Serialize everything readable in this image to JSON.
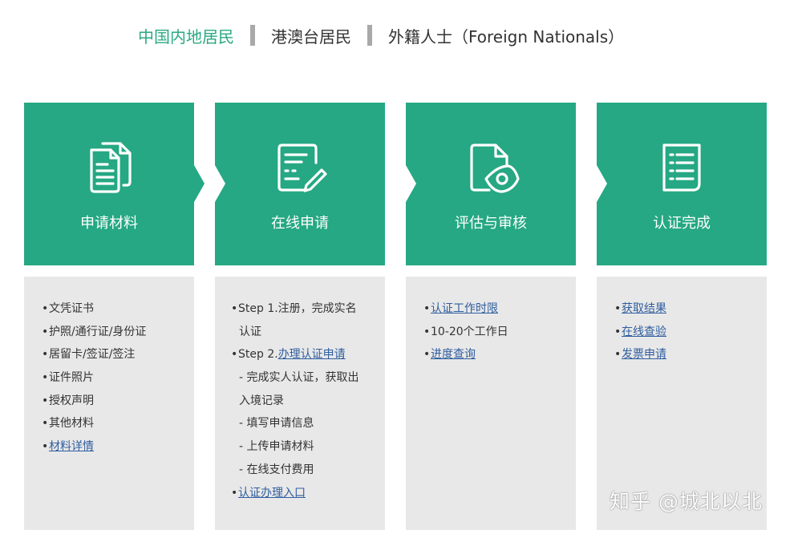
{
  "tabs": [
    {
      "label": "中国内地居民",
      "active": true
    },
    {
      "label": "港澳台居民",
      "active": false
    },
    {
      "label": "外籍人士（Foreign Nationals）",
      "active": false
    }
  ],
  "colors": {
    "accent": "#25a883",
    "active_tab": "#2aa882",
    "link": "#2f5e9f",
    "panel": "#e8e8e8"
  },
  "steps": [
    {
      "title": "申请材料",
      "icon": "documents-icon",
      "items": [
        {
          "text": "文凭证书"
        },
        {
          "text": "护照/通行证/身份证"
        },
        {
          "text": "居留卡/签证/签注"
        },
        {
          "text": "证件照片"
        },
        {
          "text": "授权声明"
        },
        {
          "text": "其他材料"
        },
        {
          "text": "材料详情",
          "link": true
        }
      ]
    },
    {
      "title": "在线申请",
      "icon": "form-edit-icon",
      "items": {
        "step1_a": "Step 1.注册，完成实名",
        "step1_b": "认证",
        "step2_prefix": "Step 2.",
        "step2_link": "办理认证申请",
        "sub1_a": "- 完成实人认证，获取出",
        "sub1_b": "入境记录",
        "sub2": "- 填写申请信息",
        "sub3": "- 上传申请材料",
        "sub4": "- 在线支付费用",
        "entry_link": "认证办理入口"
      }
    },
    {
      "title": "评估与审核",
      "icon": "document-eye-icon",
      "items": [
        {
          "text": "认证工作时限",
          "link": true
        },
        {
          "text": "10-20个工作日"
        },
        {
          "text": "进度查询",
          "link": true
        }
      ]
    },
    {
      "title": "认证完成",
      "icon": "checklist-icon",
      "items": [
        {
          "text": "获取结果",
          "link": true
        },
        {
          "text": "在线查验",
          "link": true
        },
        {
          "text": "发票申请",
          "link": true
        }
      ]
    }
  ],
  "bullet": "•",
  "watermark": "知乎 @城北以北"
}
